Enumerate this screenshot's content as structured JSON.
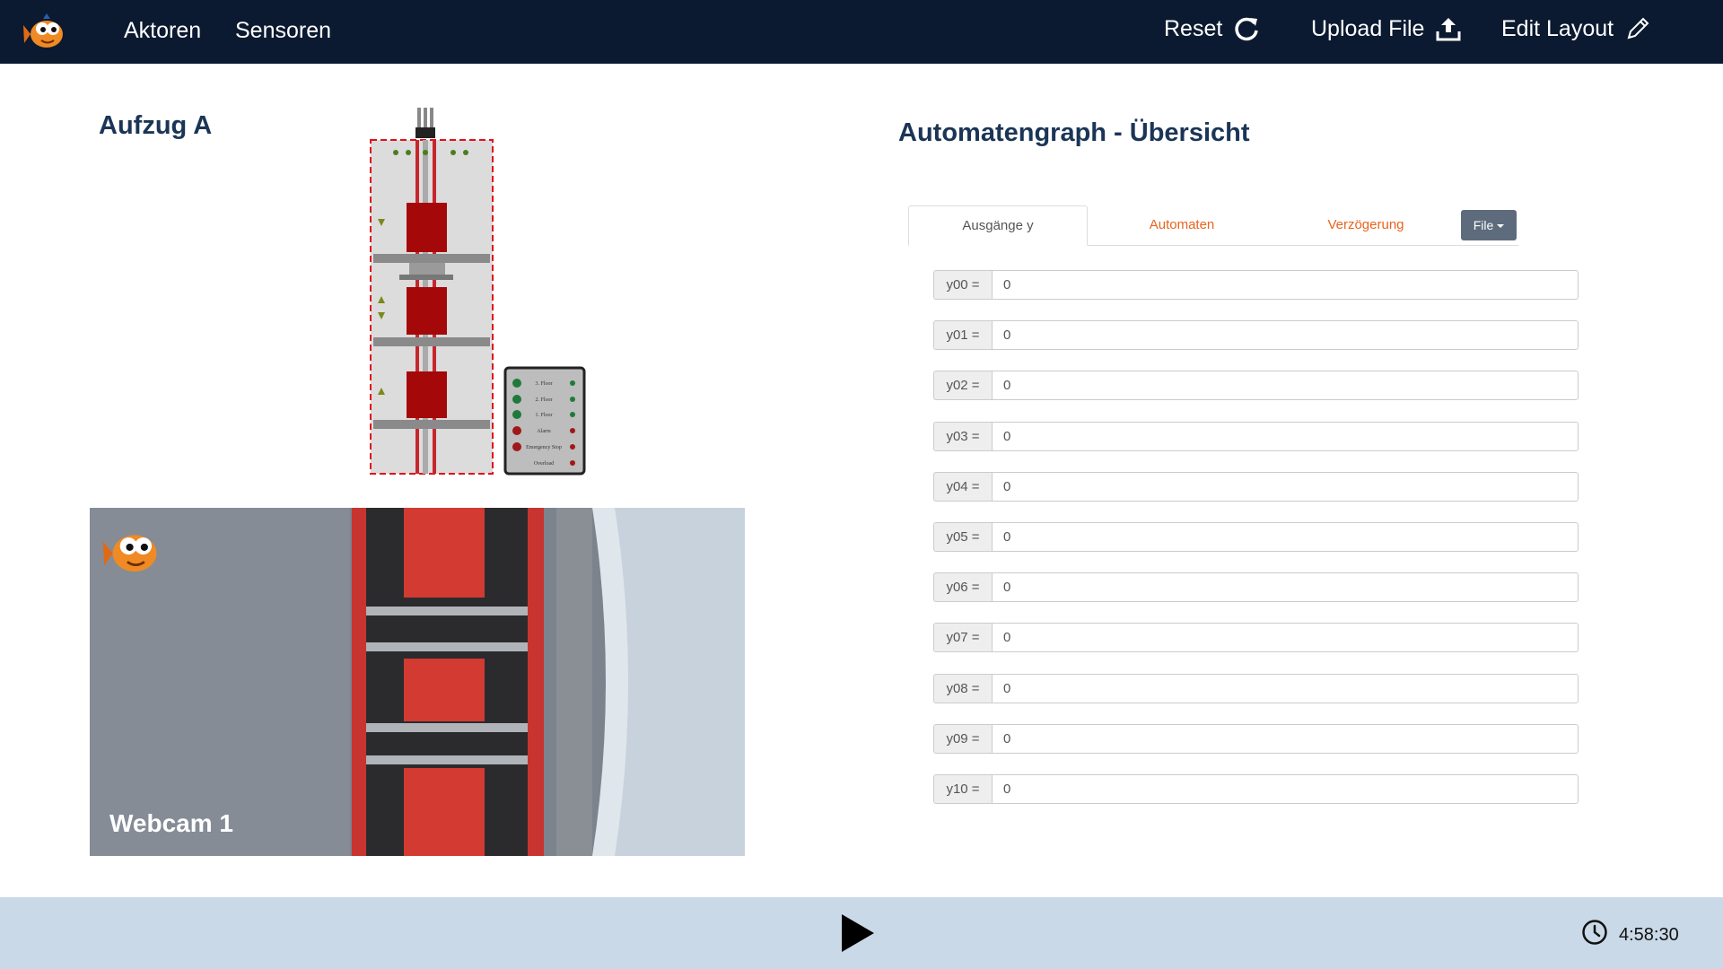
{
  "nav": {
    "left_items": [
      {
        "label": "Aktoren"
      },
      {
        "label": "Sensoren"
      }
    ],
    "reset_label": "Reset",
    "upload_label": "Upload File",
    "edit_label": "Edit Layout",
    "icons": {
      "logo": "fish-logo-icon",
      "reset": "refresh-icon",
      "upload": "upload-icon",
      "edit": "pencil-icon"
    }
  },
  "left": {
    "elevator_title": "Aufzug A",
    "panel_labels": [
      "3. Floor",
      "2. Floor",
      "1. Floor",
      "Alarm",
      "Emergency Stop",
      "Overload"
    ],
    "webcam_label": "Webcam 1"
  },
  "right": {
    "title": "Automatengraph - Übersicht",
    "tabs": [
      "Ausgänge y",
      "Automaten",
      "Verzögerung"
    ],
    "file_button": "File",
    "outputs": [
      {
        "label": "y00 =",
        "value": "0"
      },
      {
        "label": "y01 =",
        "value": "0"
      },
      {
        "label": "y02 =",
        "value": "0"
      },
      {
        "label": "y03 =",
        "value": "0"
      },
      {
        "label": "y04 =",
        "value": "0"
      },
      {
        "label": "y05 =",
        "value": "0"
      },
      {
        "label": "y06 =",
        "value": "0"
      },
      {
        "label": "y07 =",
        "value": "0"
      },
      {
        "label": "y08 =",
        "value": "0"
      },
      {
        "label": "y09 =",
        "value": "0"
      },
      {
        "label": "y10 =",
        "value": "0"
      }
    ]
  },
  "bottom": {
    "time": "4:58:30",
    "icons": {
      "play": "play-icon",
      "clock": "clock-icon"
    }
  },
  "colors": {
    "topbar": "#0b1a30",
    "title": "#1b3557",
    "tab_link": "#e8641e",
    "bottombar": "#c9d9e8",
    "file_button": "#5d6b7d"
  }
}
